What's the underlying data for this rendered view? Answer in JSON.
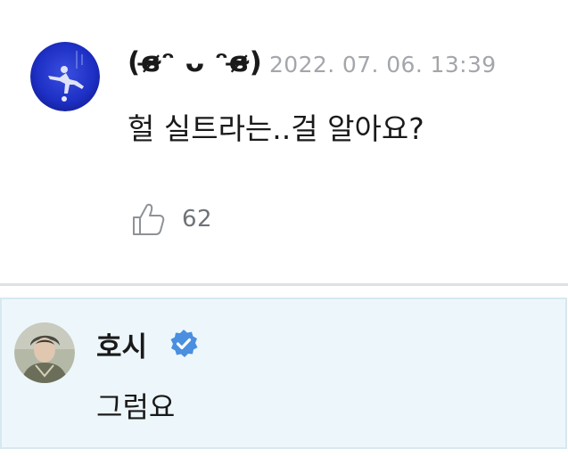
{
  "comment": {
    "author": "(ɞ̴̶̷ᵔ ᴗ ᵔɞ̴̶̷)",
    "timestamp": "2022. 07. 06. 13:39",
    "text": "헐 실트라는..걸 알아요?",
    "likes": "62",
    "avatar_icon": "avatar-photo-performer",
    "like_icon": "thumbs-up-outline-icon"
  },
  "reply": {
    "author": "호시",
    "verified_icon": "verified-badge-icon",
    "verified_color": "#4a8fe0",
    "text": "그럼요",
    "avatar_icon": "avatar-photo-artist"
  },
  "colors": {
    "reply_background": "#edf7fb",
    "timestamp_gray": "#a3a6ab"
  }
}
